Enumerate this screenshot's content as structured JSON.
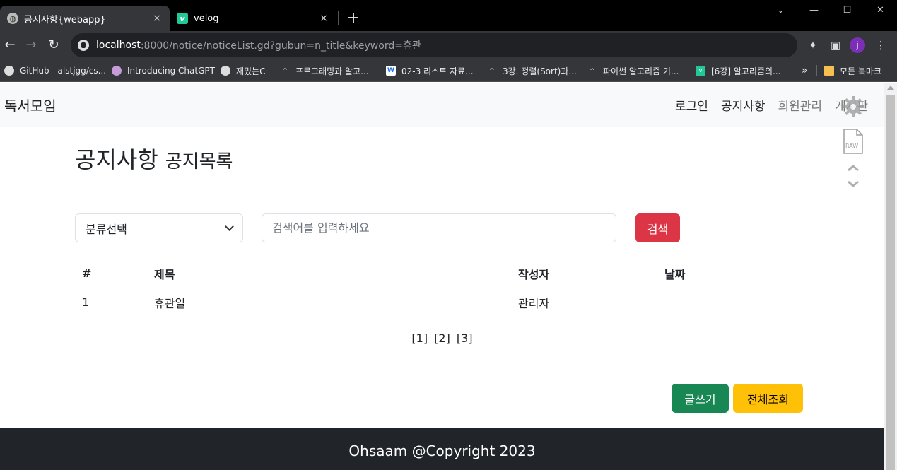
{
  "browser": {
    "tabs": [
      {
        "title": "공지사항{webapp}",
        "active": true
      },
      {
        "title": "velog",
        "active": false
      }
    ],
    "close_glyph": "×",
    "new_tab_glyph": "+",
    "window_controls": {
      "dropdown": "⌄",
      "minimize": "—",
      "maximize": "☐",
      "close": "✕"
    },
    "nav": {
      "back": "←",
      "forward": "→",
      "reload": "↻"
    },
    "url_host": "localhost",
    "url_rest": ":8000/notice/noticeList.gd?gubun=n_title&keyword=휴관",
    "profile_initial": "j",
    "bookmarks": [
      {
        "label": "GitHub - alstjgg/cs...",
        "icon": "github-icon"
      },
      {
        "label": "Introducing ChatGPT",
        "icon": "openai-icon"
      },
      {
        "label": "재밌는C",
        "icon": "globe-icon"
      },
      {
        "label": "프로그래밍과 알고...",
        "icon": "dots-icon"
      },
      {
        "label": "02-3 리스트 자료...",
        "icon": "w-icon"
      },
      {
        "label": "3강. 정렬(Sort)과...",
        "icon": "dots-icon"
      },
      {
        "label": "파이썬 알고리즘 기...",
        "icon": "dots-icon"
      },
      {
        "label": "[6강] 알고리즘의...",
        "icon": "velog-icon"
      }
    ],
    "bookmarks_overflow": "»",
    "bookmarks_folder": "모든 북마크"
  },
  "site": {
    "brand": "독서모임",
    "nav": [
      "로그인",
      "공지사항",
      "회원관리",
      "게시판"
    ]
  },
  "page": {
    "title": "공지사항",
    "subtitle": "공지목록"
  },
  "search": {
    "select_value": "분류선택",
    "placeholder": "검색어를 입력하세요",
    "button": "검색"
  },
  "table": {
    "headers": [
      "#",
      "제목",
      "작성자",
      "날짜"
    ],
    "rows": [
      {
        "no": "1",
        "title": "휴관일",
        "writer": "관리자",
        "date": ""
      }
    ]
  },
  "pagination": [
    "[1]",
    "[2]",
    "[3]"
  ],
  "actions": {
    "write": "글쓰기",
    "list_all": "전체조회"
  },
  "footer": "Ohsaam @Copyright 2023"
}
